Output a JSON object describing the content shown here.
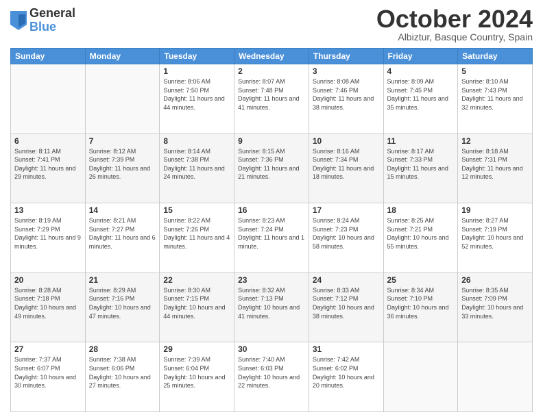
{
  "logo": {
    "general": "General",
    "blue": "Blue"
  },
  "header": {
    "month": "October 2024",
    "location": "Albiztur, Basque Country, Spain"
  },
  "weekdays": [
    "Sunday",
    "Monday",
    "Tuesday",
    "Wednesday",
    "Thursday",
    "Friday",
    "Saturday"
  ],
  "weeks": [
    {
      "shade": false,
      "days": [
        {
          "num": "",
          "info": ""
        },
        {
          "num": "",
          "info": ""
        },
        {
          "num": "1",
          "info": "Sunrise: 8:06 AM\nSunset: 7:50 PM\nDaylight: 11 hours and 44 minutes."
        },
        {
          "num": "2",
          "info": "Sunrise: 8:07 AM\nSunset: 7:48 PM\nDaylight: 11 hours and 41 minutes."
        },
        {
          "num": "3",
          "info": "Sunrise: 8:08 AM\nSunset: 7:46 PM\nDaylight: 11 hours and 38 minutes."
        },
        {
          "num": "4",
          "info": "Sunrise: 8:09 AM\nSunset: 7:45 PM\nDaylight: 11 hours and 35 minutes."
        },
        {
          "num": "5",
          "info": "Sunrise: 8:10 AM\nSunset: 7:43 PM\nDaylight: 11 hours and 32 minutes."
        }
      ]
    },
    {
      "shade": true,
      "days": [
        {
          "num": "6",
          "info": "Sunrise: 8:11 AM\nSunset: 7:41 PM\nDaylight: 11 hours and 29 minutes."
        },
        {
          "num": "7",
          "info": "Sunrise: 8:12 AM\nSunset: 7:39 PM\nDaylight: 11 hours and 26 minutes."
        },
        {
          "num": "8",
          "info": "Sunrise: 8:14 AM\nSunset: 7:38 PM\nDaylight: 11 hours and 24 minutes."
        },
        {
          "num": "9",
          "info": "Sunrise: 8:15 AM\nSunset: 7:36 PM\nDaylight: 11 hours and 21 minutes."
        },
        {
          "num": "10",
          "info": "Sunrise: 8:16 AM\nSunset: 7:34 PM\nDaylight: 11 hours and 18 minutes."
        },
        {
          "num": "11",
          "info": "Sunrise: 8:17 AM\nSunset: 7:33 PM\nDaylight: 11 hours and 15 minutes."
        },
        {
          "num": "12",
          "info": "Sunrise: 8:18 AM\nSunset: 7:31 PM\nDaylight: 11 hours and 12 minutes."
        }
      ]
    },
    {
      "shade": false,
      "days": [
        {
          "num": "13",
          "info": "Sunrise: 8:19 AM\nSunset: 7:29 PM\nDaylight: 11 hours and 9 minutes."
        },
        {
          "num": "14",
          "info": "Sunrise: 8:21 AM\nSunset: 7:27 PM\nDaylight: 11 hours and 6 minutes."
        },
        {
          "num": "15",
          "info": "Sunrise: 8:22 AM\nSunset: 7:26 PM\nDaylight: 11 hours and 4 minutes."
        },
        {
          "num": "16",
          "info": "Sunrise: 8:23 AM\nSunset: 7:24 PM\nDaylight: 11 hours and 1 minute."
        },
        {
          "num": "17",
          "info": "Sunrise: 8:24 AM\nSunset: 7:23 PM\nDaylight: 10 hours and 58 minutes."
        },
        {
          "num": "18",
          "info": "Sunrise: 8:25 AM\nSunset: 7:21 PM\nDaylight: 10 hours and 55 minutes."
        },
        {
          "num": "19",
          "info": "Sunrise: 8:27 AM\nSunset: 7:19 PM\nDaylight: 10 hours and 52 minutes."
        }
      ]
    },
    {
      "shade": true,
      "days": [
        {
          "num": "20",
          "info": "Sunrise: 8:28 AM\nSunset: 7:18 PM\nDaylight: 10 hours and 49 minutes."
        },
        {
          "num": "21",
          "info": "Sunrise: 8:29 AM\nSunset: 7:16 PM\nDaylight: 10 hours and 47 minutes."
        },
        {
          "num": "22",
          "info": "Sunrise: 8:30 AM\nSunset: 7:15 PM\nDaylight: 10 hours and 44 minutes."
        },
        {
          "num": "23",
          "info": "Sunrise: 8:32 AM\nSunset: 7:13 PM\nDaylight: 10 hours and 41 minutes."
        },
        {
          "num": "24",
          "info": "Sunrise: 8:33 AM\nSunset: 7:12 PM\nDaylight: 10 hours and 38 minutes."
        },
        {
          "num": "25",
          "info": "Sunrise: 8:34 AM\nSunset: 7:10 PM\nDaylight: 10 hours and 36 minutes."
        },
        {
          "num": "26",
          "info": "Sunrise: 8:35 AM\nSunset: 7:09 PM\nDaylight: 10 hours and 33 minutes."
        }
      ]
    },
    {
      "shade": false,
      "days": [
        {
          "num": "27",
          "info": "Sunrise: 7:37 AM\nSunset: 6:07 PM\nDaylight: 10 hours and 30 minutes."
        },
        {
          "num": "28",
          "info": "Sunrise: 7:38 AM\nSunset: 6:06 PM\nDaylight: 10 hours and 27 minutes."
        },
        {
          "num": "29",
          "info": "Sunrise: 7:39 AM\nSunset: 6:04 PM\nDaylight: 10 hours and 25 minutes."
        },
        {
          "num": "30",
          "info": "Sunrise: 7:40 AM\nSunset: 6:03 PM\nDaylight: 10 hours and 22 minutes."
        },
        {
          "num": "31",
          "info": "Sunrise: 7:42 AM\nSunset: 6:02 PM\nDaylight: 10 hours and 20 minutes."
        },
        {
          "num": "",
          "info": ""
        },
        {
          "num": "",
          "info": ""
        }
      ]
    }
  ]
}
